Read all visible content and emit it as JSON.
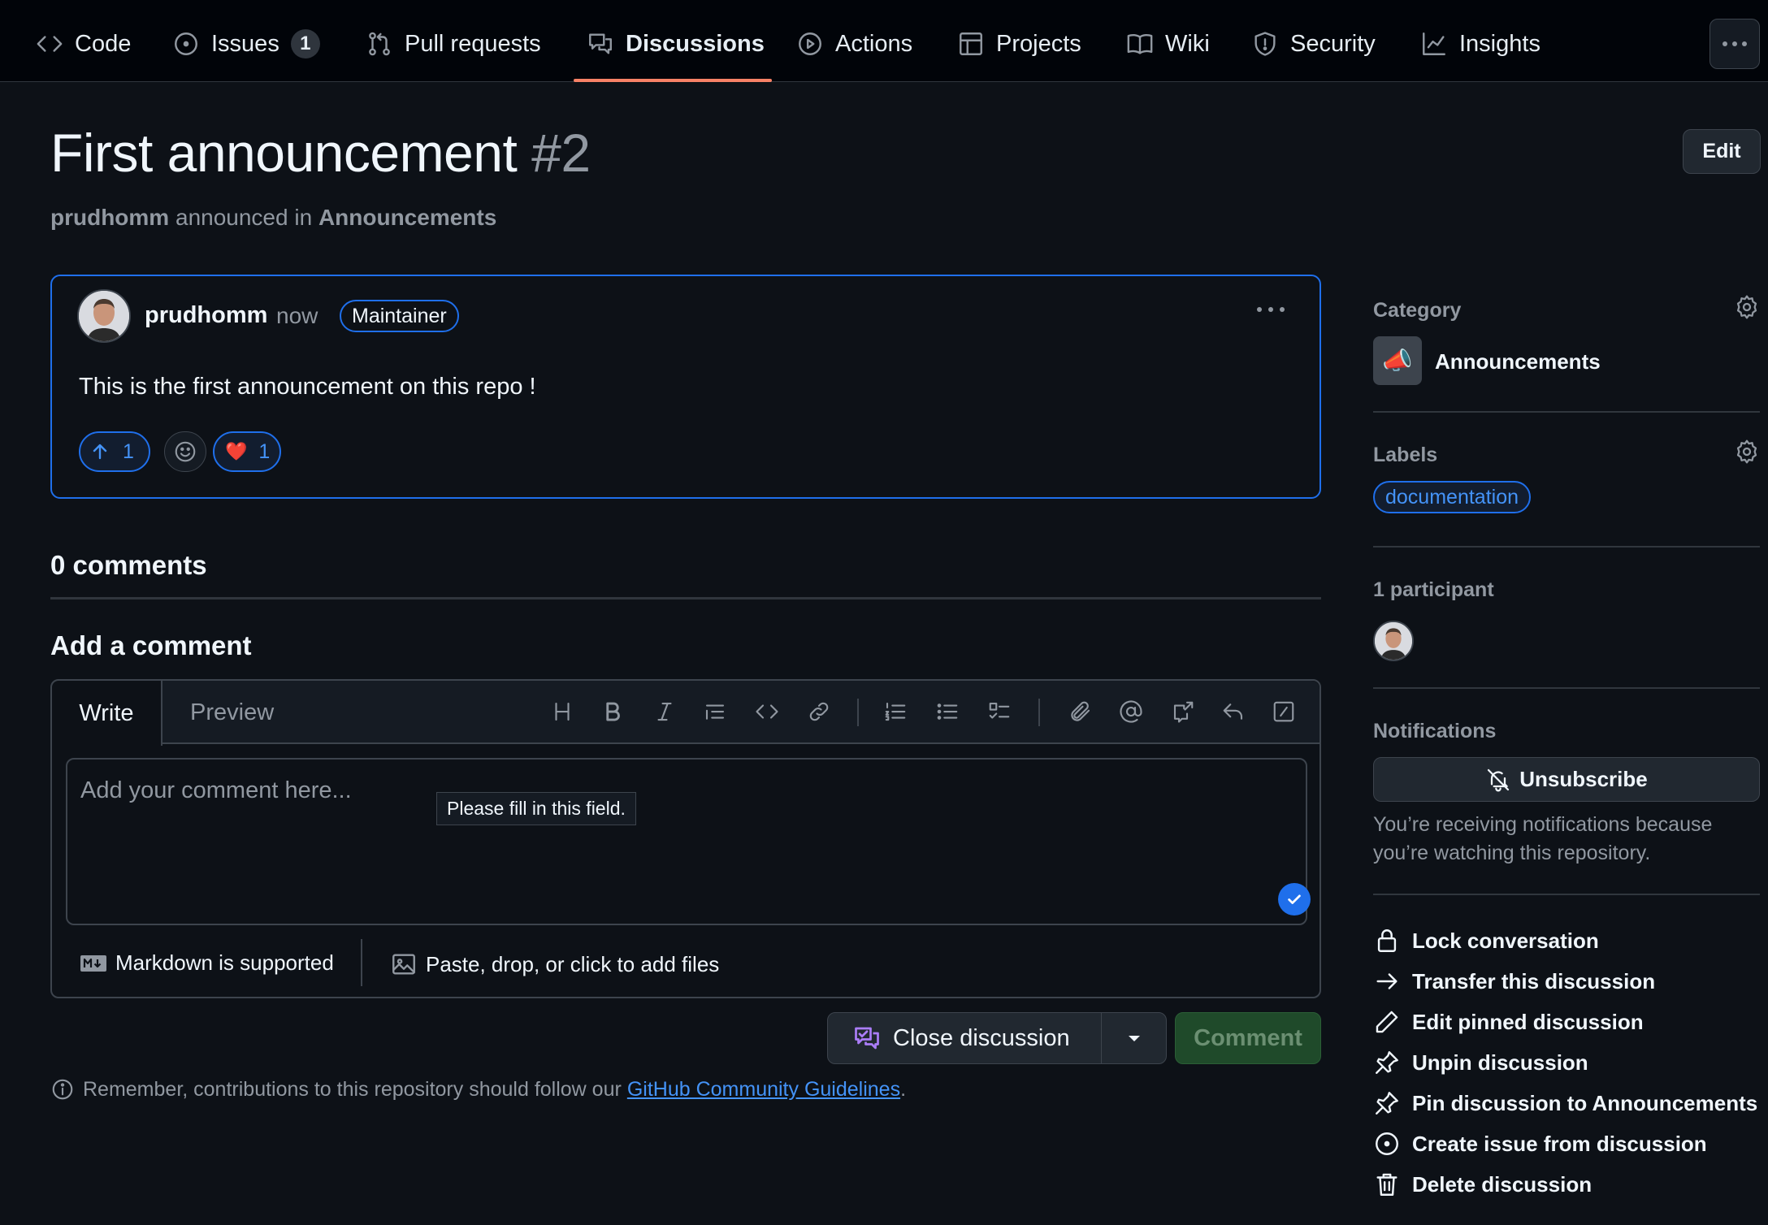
{
  "nav": {
    "tabs": [
      {
        "label": "Code",
        "icon": "code-icon"
      },
      {
        "label": "Issues",
        "icon": "issue-opened-icon",
        "count": "1"
      },
      {
        "label": "Pull requests",
        "icon": "git-pull-request-icon"
      },
      {
        "label": "Discussions",
        "icon": "comment-discussion-icon",
        "active": true
      },
      {
        "label": "Actions",
        "icon": "play-icon"
      },
      {
        "label": "Projects",
        "icon": "table-icon"
      },
      {
        "label": "Wiki",
        "icon": "book-icon"
      },
      {
        "label": "Security",
        "icon": "shield-icon"
      },
      {
        "label": "Insights",
        "icon": "graph-icon"
      }
    ],
    "more_label": "···"
  },
  "discussion": {
    "title": "First announcement",
    "number": "#2",
    "author": "prudhomm",
    "action_text": "announced in",
    "category": "Announcements",
    "edit_label": "Edit"
  },
  "post": {
    "author": "prudhomm",
    "time": "now",
    "role_badge": "Maintainer",
    "body": "This is the first announcement on this repo !",
    "upvotes": "1",
    "heart_count": "1",
    "heart_emoji": "❤️"
  },
  "comments": {
    "count_label": "0 comments",
    "add_heading": "Add a comment",
    "tab_write": "Write",
    "tab_preview": "Preview",
    "placeholder": "Add your comment here...",
    "validation_tooltip": "Please fill in this field.",
    "markdown_note": "Markdown is supported",
    "files_note": "Paste, drop, or click to add files",
    "close_label": "Close discussion",
    "comment_label": "Comment",
    "guidelines_prefix": "Remember, contributions to this repository should follow our",
    "guidelines_link": "GitHub Community Guidelines",
    "guidelines_suffix": "."
  },
  "sidebar": {
    "category_heading": "Category",
    "category_name": "Announcements",
    "category_emoji": "📣",
    "labels_heading": "Labels",
    "label": "documentation",
    "participants_heading": "1 participant",
    "notifications_heading": "Notifications",
    "unsubscribe_label": "Unsubscribe",
    "notif_text": "You’re receiving notifications because you’re watching this repository.",
    "actions": [
      {
        "label": "Lock conversation",
        "icon": "lock-icon"
      },
      {
        "label": "Transfer this discussion",
        "icon": "arrow-right-icon"
      },
      {
        "label": "Edit pinned discussion",
        "icon": "pencil-icon"
      },
      {
        "label": "Unpin discussion",
        "icon": "pin-slash-icon"
      },
      {
        "label": "Pin discussion to Announcements",
        "icon": "pin-icon"
      },
      {
        "label": "Create issue from discussion",
        "icon": "issue-opened-icon"
      },
      {
        "label": "Delete discussion",
        "icon": "trash-icon"
      }
    ]
  },
  "colors": {
    "background": "#0d1117",
    "nav_background": "#010409",
    "accent_blue": "#1f6feb",
    "link_blue": "#4493f8",
    "tab_underline": "#f78166",
    "comment_button": "#1f4a2a"
  }
}
